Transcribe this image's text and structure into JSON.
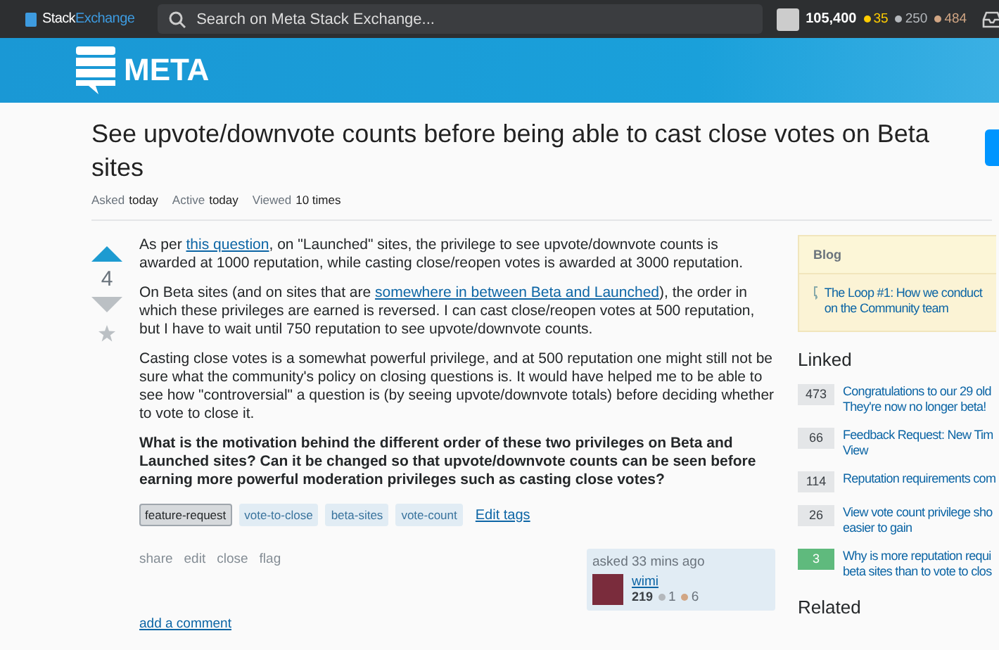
{
  "topbar": {
    "logo": {
      "first": "Stack",
      "second": "Exchange"
    },
    "search": {
      "placeholder": "Search on Meta Stack Exchange..."
    },
    "user": {
      "reputation": "105,400",
      "badges": [
        {
          "kind": "gold",
          "count": "35"
        },
        {
          "kind": "silver",
          "count": "250"
        },
        {
          "kind": "bronze",
          "count": "484"
        }
      ]
    }
  },
  "banner": {
    "site_name": "META"
  },
  "question": {
    "title": "See upvote/downvote counts before being able to cast close votes on Beta sites",
    "meta": [
      {
        "label": "Asked",
        "value": "today"
      },
      {
        "label": "Active",
        "value": "today"
      },
      {
        "label": "Viewed",
        "value": "10 times"
      }
    ],
    "score": "4",
    "body": [
      {
        "kind": "text",
        "parts": [
          {
            "text": "As per "
          },
          {
            "text": "this question",
            "link": true
          },
          {
            "text": ", on \"Launched\" sites, the privilege to see upvote/downvote counts is awarded at 1000 reputation, while casting close/reopen votes is awarded at 3000 reputation."
          }
        ]
      },
      {
        "kind": "text",
        "parts": [
          {
            "text": "On Beta sites (and on sites that are "
          },
          {
            "text": "somewhere in between Beta and Launched",
            "link": true
          },
          {
            "text": "), the order in which these privileges are earned is reversed. I can cast close/reopen votes at 500 reputation, but I have to wait until 750 reputation to see upvote/downvote counts."
          }
        ]
      },
      {
        "kind": "text",
        "parts": [
          {
            "text": "Casting close votes is a somewhat powerful privilege, and at 500 reputation one might still not be sure what the community's policy on closing questions is. It would have helped me to be able to see how \"controversial\" a question is (by seeing upvote/downvote totals) before deciding whether to vote to close it."
          }
        ]
      },
      {
        "kind": "bold",
        "parts": [
          {
            "text": "What is the motivation behind the different order of these two privileges on Beta and Launched sites? Can it be changed so that upvote/downvote counts can be seen before earning more powerful moderation privileges such as casting close votes?"
          }
        ]
      }
    ],
    "tags": [
      {
        "label": "feature-request",
        "selected": true
      },
      {
        "label": "vote-to-close",
        "selected": false
      },
      {
        "label": "beta-sites",
        "selected": false
      },
      {
        "label": "vote-count",
        "selected": false
      }
    ],
    "edit_tags": "Edit tags",
    "menu": [
      "share",
      "edit",
      "close",
      "flag"
    ],
    "asker": {
      "asked": "asked 33 mins ago",
      "name": "wimi",
      "reputation": "219",
      "badges": [
        {
          "kind": "silver",
          "count": "1"
        },
        {
          "kind": "bronze",
          "count": "6"
        }
      ]
    },
    "add_comment": "add a comment"
  },
  "sidebar": {
    "blog": {
      "heading": "Blog",
      "items": [
        {
          "lines": [
            "The Loop #1: How we conduct",
            "on the Community team"
          ]
        }
      ]
    },
    "linked": {
      "heading": "Linked",
      "items": [
        {
          "count": "473",
          "accepted": false,
          "lines": [
            "Congratulations to our 29 old",
            "They're now no longer beta!"
          ]
        },
        {
          "count": "66",
          "accepted": false,
          "lines": [
            "Feedback Request: New Tim",
            "View"
          ]
        },
        {
          "count": "114",
          "accepted": false,
          "lines": [
            "Reputation requirements com"
          ]
        },
        {
          "count": "26",
          "accepted": false,
          "lines": [
            "View vote count privilege sho",
            "easier to gain"
          ]
        },
        {
          "count": "3",
          "accepted": true,
          "lines": [
            "Why is more reputation requi",
            "beta sites than to vote to clos"
          ]
        }
      ]
    },
    "related": {
      "heading": "Related"
    }
  }
}
